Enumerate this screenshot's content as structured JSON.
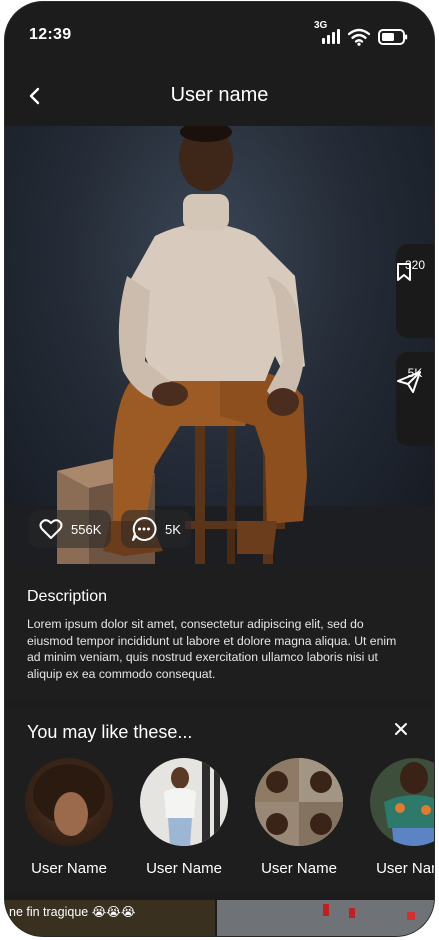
{
  "status_bar": {
    "time": "12:39",
    "network": "3G"
  },
  "header": {
    "title": "User name"
  },
  "post": {
    "saves": "320",
    "shares": "5K",
    "likes": "556K",
    "comments": "5K"
  },
  "description": {
    "title": "Description",
    "body": "Lorem ipsum dolor sit amet, consectetur adipiscing elit, sed do eiusmod tempor incididunt ut labore et dolore magna aliqua. Ut enim ad minim veniam, quis nostrud exercitation ullamco laboris nisi ut aliquip ex ea commodo consequat."
  },
  "suggestions": {
    "title": "You may like these...",
    "users": [
      {
        "name": "User Name"
      },
      {
        "name": "User Name"
      },
      {
        "name": "User Name"
      },
      {
        "name": "User Name"
      }
    ]
  },
  "feed_preview": {
    "caption": "ne fin tragique 😭😭😭"
  },
  "colors": {
    "background": "#1c1c1c",
    "panel": "#1e1e1e",
    "text": "#ffffff"
  },
  "icons": [
    "back-icon",
    "bookmark-icon",
    "send-icon",
    "heart-icon",
    "comment-icon",
    "close-icon",
    "signal-icon",
    "wifi-icon",
    "battery-icon"
  ]
}
